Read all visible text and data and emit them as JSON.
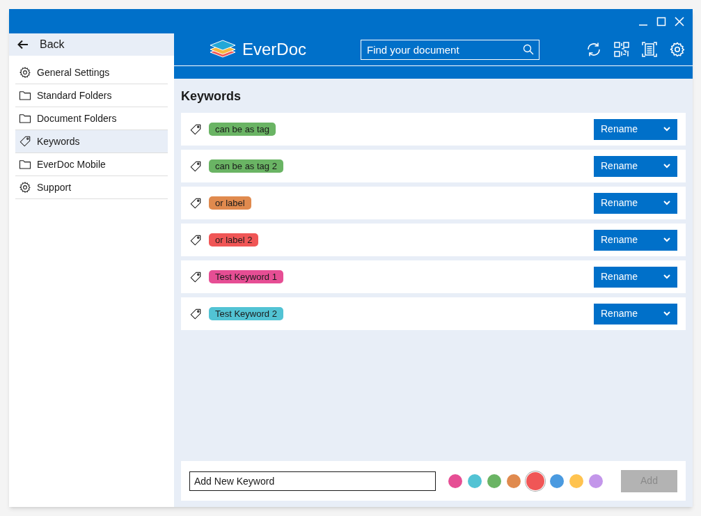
{
  "back": {
    "label": "Back"
  },
  "app": {
    "name": "EverDoc"
  },
  "search": {
    "placeholder": "Find your document"
  },
  "sidebar": {
    "items": [
      {
        "label": "General Settings",
        "kind": "gear",
        "selected": false
      },
      {
        "label": "Standard Folders",
        "kind": "folder",
        "selected": false
      },
      {
        "label": "Document Folders",
        "kind": "folder",
        "selected": false
      },
      {
        "label": "Keywords",
        "kind": "tag",
        "selected": true
      },
      {
        "label": "EverDoc Mobile",
        "kind": "folder",
        "selected": false
      },
      {
        "label": "Support",
        "kind": "gear",
        "selected": false
      }
    ]
  },
  "page_title": "Keywords",
  "keywords": [
    {
      "label": "can be as tag",
      "color": "#6ab464",
      "button": "Rename"
    },
    {
      "label": "can be as tag 2",
      "color": "#6ab464",
      "button": "Rename"
    },
    {
      "label": "or label",
      "color": "#e08a4e",
      "button": "Rename"
    },
    {
      "label": "or label 2",
      "color": "#f05656",
      "button": "Rename"
    },
    {
      "label": "Test Keyword 1",
      "color": "#e64e94",
      "button": "Rename"
    },
    {
      "label": "Test Keyword 2",
      "color": "#52c3d4",
      "button": "Rename"
    }
  ],
  "new_keyword": {
    "value": "Add New Keyword",
    "colors": [
      {
        "color": "#e64e94",
        "selected": false
      },
      {
        "color": "#52c3d4",
        "selected": false
      },
      {
        "color": "#6ab464",
        "selected": false
      },
      {
        "color": "#e08a4e",
        "selected": false
      },
      {
        "color": "#f05656",
        "selected": true
      },
      {
        "color": "#4a9ae0",
        "selected": false
      },
      {
        "color": "#ffc34f",
        "selected": false
      },
      {
        "color": "#c396ea",
        "selected": false
      }
    ],
    "add_button": {
      "label": "Add",
      "disabled": true
    }
  }
}
